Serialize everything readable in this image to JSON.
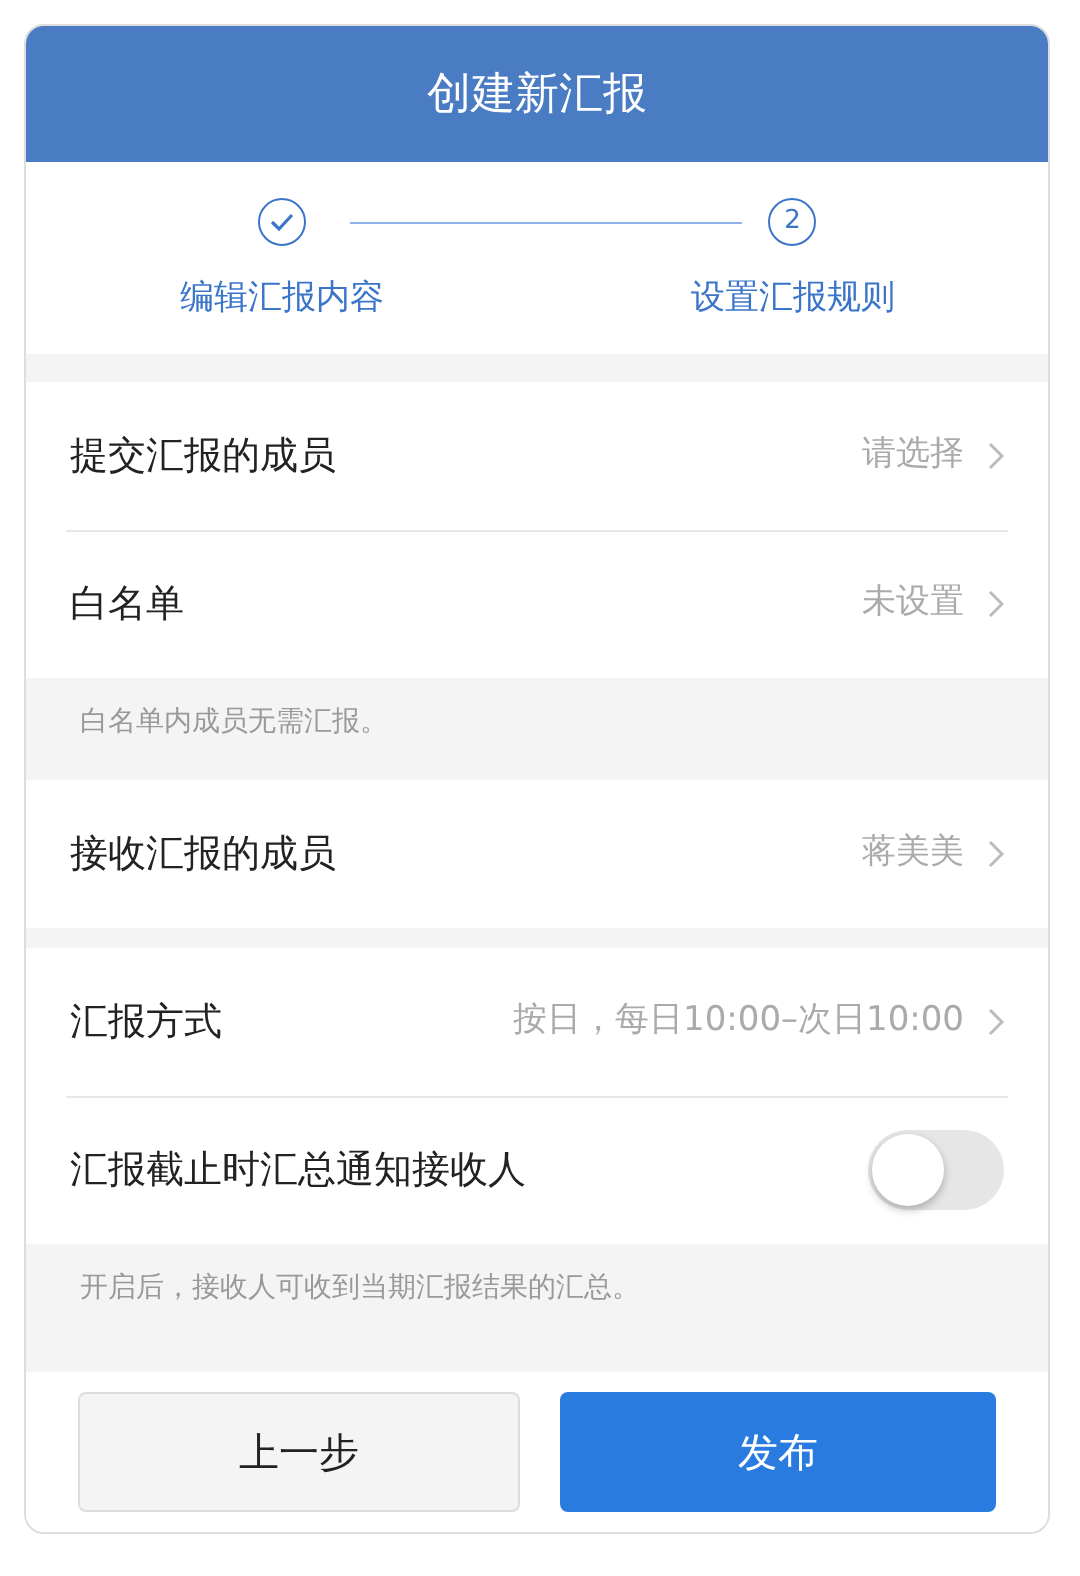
{
  "header": {
    "title": "创建新汇报"
  },
  "steps": [
    {
      "label": "编辑汇报内容",
      "done": true
    },
    {
      "label": "设置汇报规则",
      "done": false,
      "number": "2"
    }
  ],
  "sections": [
    {
      "items": [
        {
          "kind": "link",
          "label": "提交汇报的成员",
          "value": "请选择"
        },
        {
          "kind": "link",
          "label": "白名单",
          "value": "未设置"
        }
      ],
      "note": "白名单内成员无需汇报。"
    },
    {
      "items": [
        {
          "kind": "link",
          "label": "接收汇报的成员",
          "value": "蒋美美"
        }
      ]
    },
    {
      "items": [
        {
          "kind": "link",
          "label": "汇报方式",
          "value": "按日，每日10:00–次日10:00"
        },
        {
          "kind": "toggle",
          "label": "汇报截止时汇总通知接收人",
          "on": false
        }
      ],
      "note": "开启后，接收人可收到当期汇报结果的汇总。"
    }
  ],
  "buttons": [
    {
      "label": "上一步",
      "kind": "secondary"
    },
    {
      "label": "发布",
      "kind": "primary"
    }
  ]
}
